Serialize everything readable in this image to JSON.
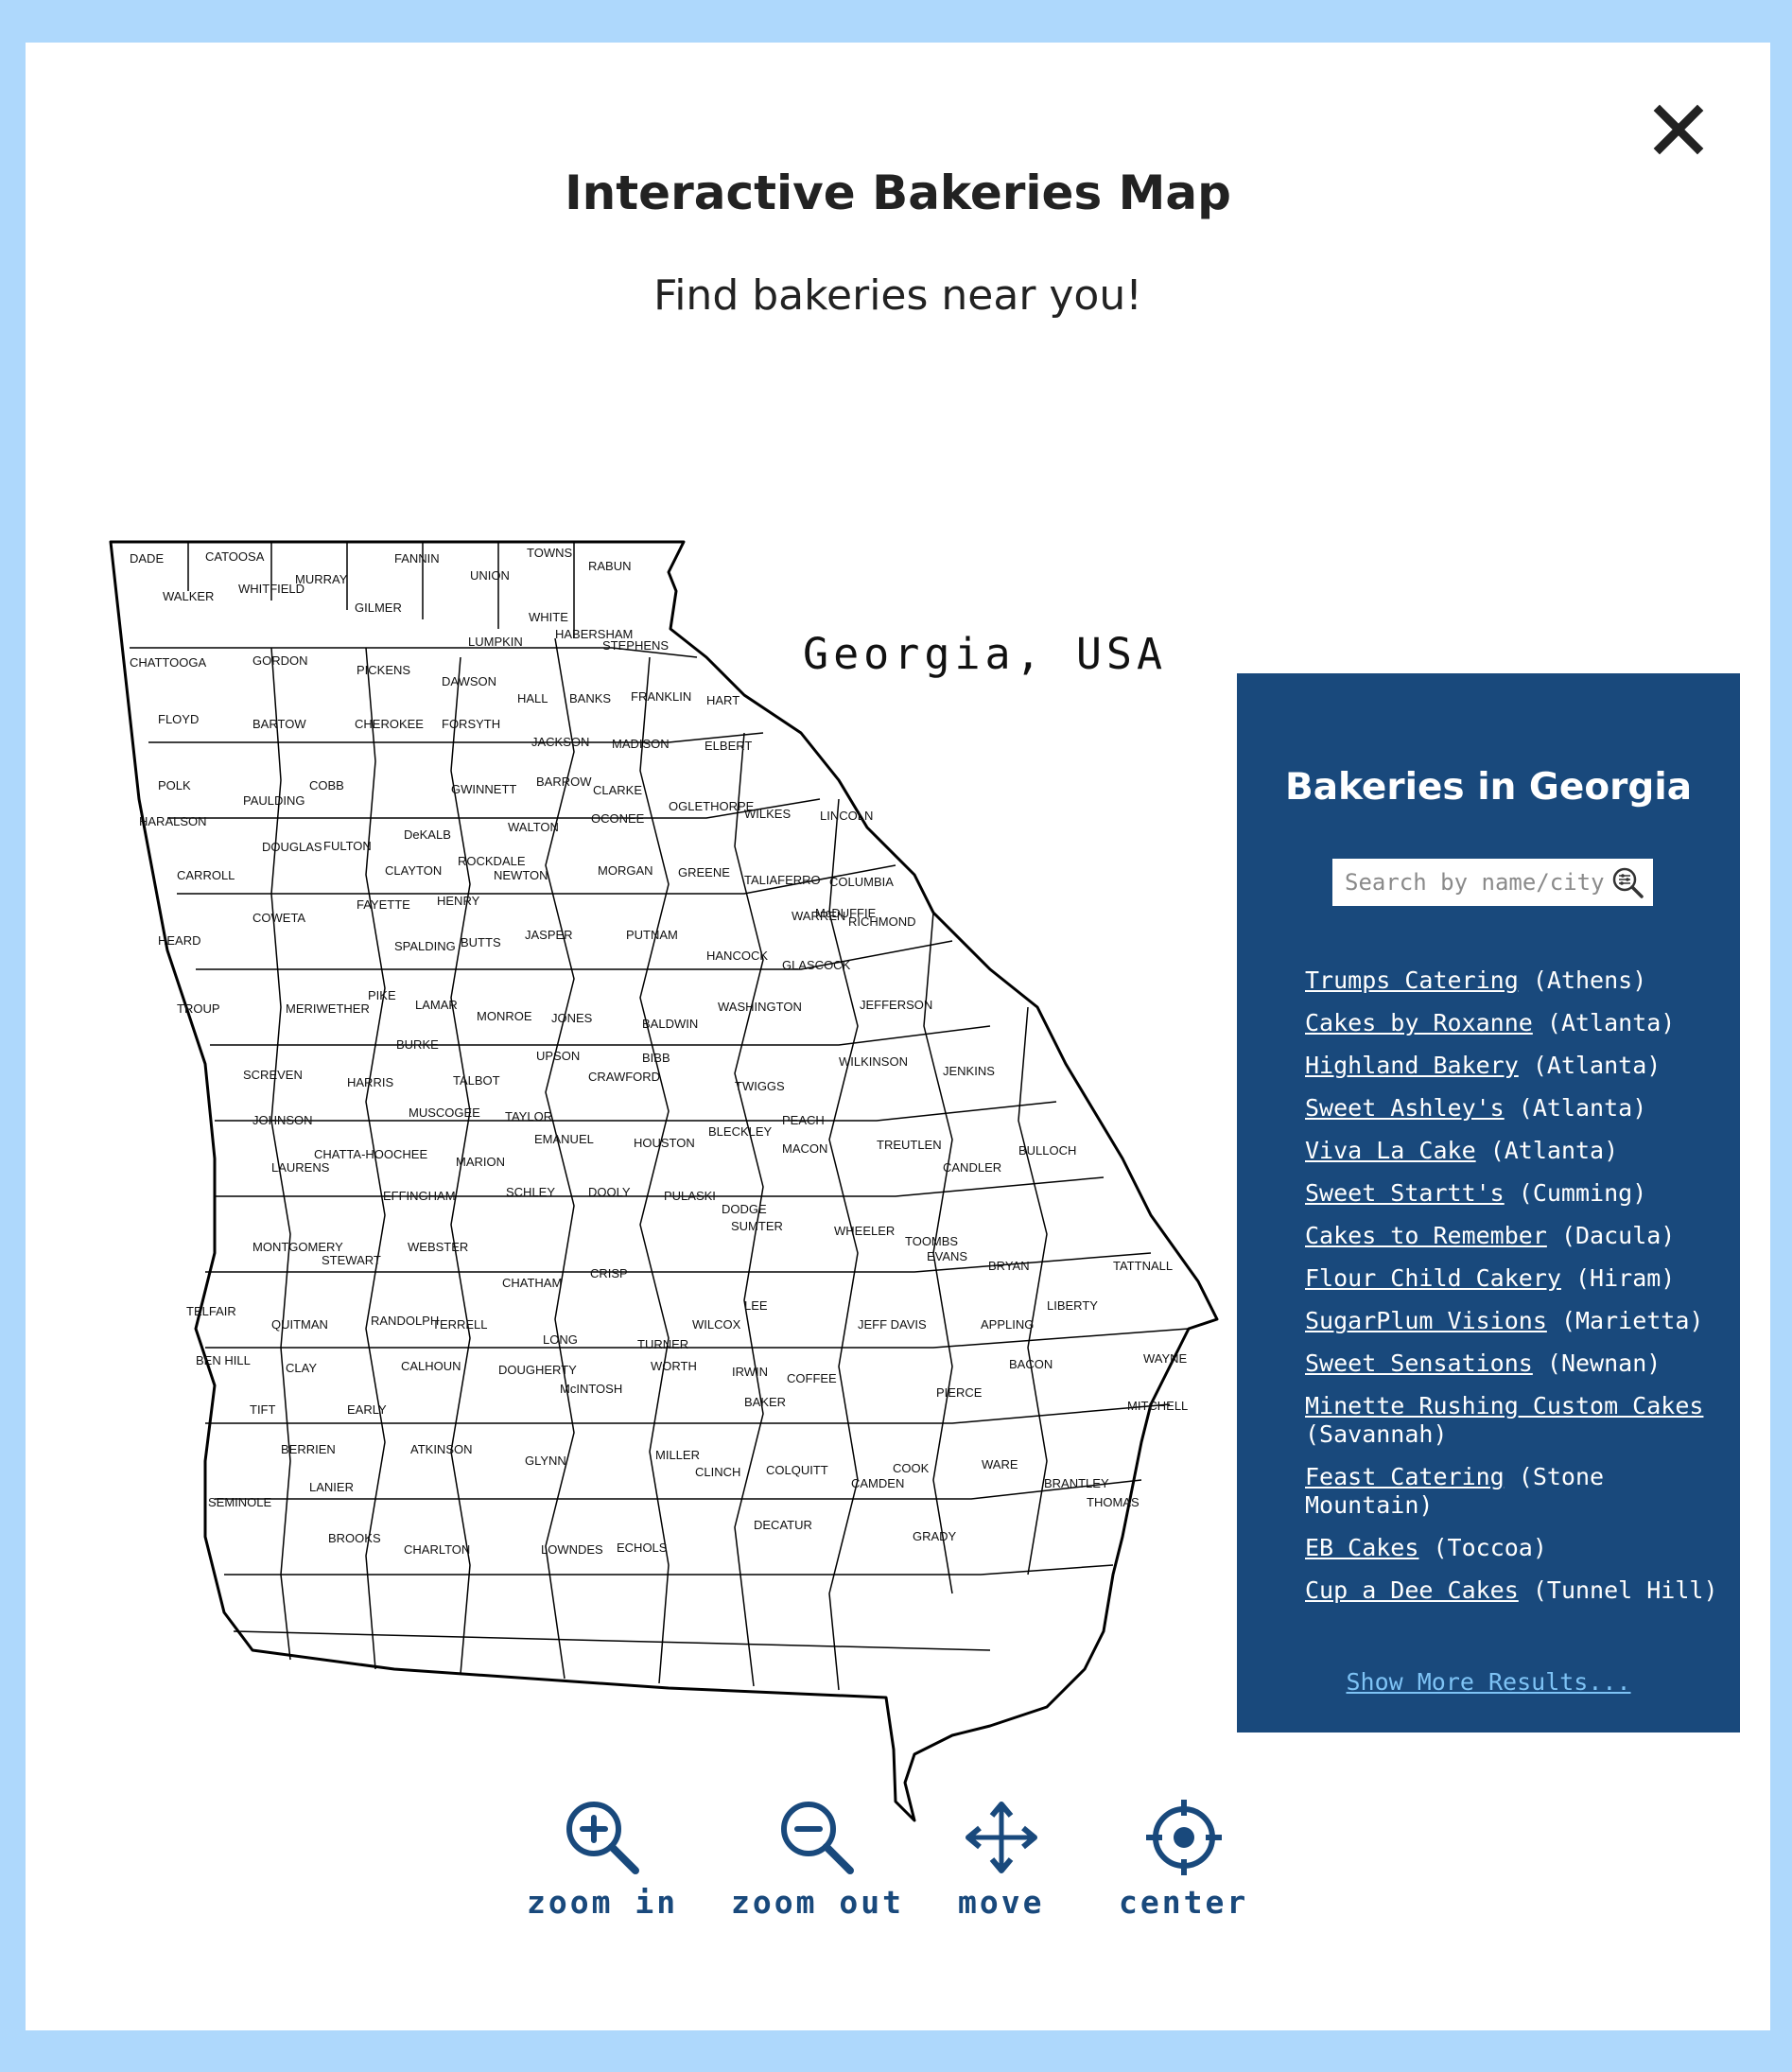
{
  "page": {
    "title": "Interactive Bakeries Map",
    "subtitle": "Find bakeries near you!",
    "close_icon": "close-icon"
  },
  "map": {
    "caption": "Georgia, USA",
    "counties": [
      "DADE",
      "CATOOSA",
      "FANNIN",
      "TOWNS",
      "UNION",
      "RABUN",
      "WALKER",
      "WHITFIELD",
      "MURRAY",
      "GILMER",
      "WHITE",
      "HABERSHAM",
      "STEPHENS",
      "LUMPKIN",
      "CHATTOOGA",
      "GORDON",
      "PICKENS",
      "DAWSON",
      "HALL",
      "BANKS",
      "FRANKLIN",
      "HART",
      "FLOYD",
      "BARTOW",
      "CHEROKEE",
      "FORSYTH",
      "JACKSON",
      "MADISON",
      "ELBERT",
      "POLK",
      "COBB",
      "GWINNETT",
      "BARROW",
      "CLARKE",
      "OGLETHORPE",
      "WILKES",
      "LINCOLN",
      "PAULDING",
      "HARALSON",
      "DOUGLAS",
      "FULTON",
      "DeKALB",
      "WALTON",
      "OCONEE",
      "ROCKDALE",
      "NEWTON",
      "MORGAN",
      "GREENE",
      "TALIAFERRO",
      "COLUMBIA",
      "CARROLL",
      "CLAYTON",
      "HENRY",
      "McDUFFIE",
      "FAYETTE",
      "COWETA",
      "WARREN",
      "RICHMOND",
      "HEARD",
      "SPALDING",
      "BUTTS",
      "JASPER",
      "PUTNAM",
      "HANCOCK",
      "GLASCOCK",
      "TROUP",
      "MERIWETHER",
      "PIKE",
      "LAMAR",
      "MONROE",
      "JONES",
      "BALDWIN",
      "WASHINGTON",
      "JEFFERSON",
      "BURKE",
      "UPSON",
      "BIBB",
      "WILKINSON",
      "JENKINS",
      "SCREVEN",
      "HARRIS",
      "TALBOT",
      "CRAWFORD",
      "TWIGGS",
      "JOHNSON",
      "MUSCOGEE",
      "TAYLOR",
      "PEACH",
      "EMANUEL",
      "HOUSTON",
      "BLECKLEY",
      "LAURENS",
      "CHATTA-HOOCHEE",
      "MARION",
      "MACON",
      "TREUTLEN",
      "CANDLER",
      "BULLOCH",
      "EFFINGHAM",
      "SCHLEY",
      "DOOLY",
      "PULASKI",
      "DODGE",
      "MONTGOMERY",
      "STEWART",
      "WEBSTER",
      "SUMTER",
      "WHEELER",
      "TOOMBS",
      "EVANS",
      "BRYAN",
      "TATTNALL",
      "CHATHAM",
      "CRISP",
      "WILCOX",
      "TELFAIR",
      "QUITMAN",
      "RANDOLPH",
      "TERRELL",
      "LEE",
      "JEFF DAVIS",
      "APPLING",
      "LIBERTY",
      "LONG",
      "TURNER",
      "BEN HILL",
      "CLAY",
      "CALHOUN",
      "DOUGHERTY",
      "WORTH",
      "IRWIN",
      "COFFEE",
      "BACON",
      "WAYNE",
      "McINTOSH",
      "TIFT",
      "EARLY",
      "BAKER",
      "PIERCE",
      "MITCHELL",
      "BERRIEN",
      "ATKINSON",
      "GLYNN",
      "MILLER",
      "COLQUITT",
      "COOK",
      "WARE",
      "BRANTLEY",
      "SEMINOLE",
      "LANIER",
      "CLINCH",
      "CAMDEN",
      "DECATUR",
      "GRADY",
      "THOMAS",
      "BROOKS",
      "CHARLTON",
      "LOWNDES",
      "ECHOLS"
    ]
  },
  "panel": {
    "title": "Bakeries in Georgia",
    "search_placeholder": "Search by name/city",
    "search_icon": "search-filter-icon",
    "show_more": "Show More Results...",
    "bakeries": [
      {
        "name": "Trumps Catering",
        "city": "(Athens)"
      },
      {
        "name": "Cakes by Roxanne",
        "city": "(Atlanta)"
      },
      {
        "name": "Highland Bakery",
        "city": "(Atlanta)"
      },
      {
        "name": "Sweet Ashley's",
        "city": "(Atlanta)"
      },
      {
        "name": "Viva La Cake",
        "city": "(Atlanta)"
      },
      {
        "name": "Sweet Startt's",
        "city": "(Cumming)"
      },
      {
        "name": "Cakes to Remember",
        "city": "(Dacula)"
      },
      {
        "name": "Flour Child Cakery",
        "city": "(Hiram)"
      },
      {
        "name": "SugarPlum Visions",
        "city": "(Marietta)"
      },
      {
        "name": "Sweet Sensations",
        "city": "(Newnan)"
      },
      {
        "name": "Minette Rushing Custom Cakes",
        "city": "(Savannah)"
      },
      {
        "name": "Feast Catering",
        "city": "(Stone Mountain)"
      },
      {
        "name": "EB Cakes",
        "city": "(Toccoa)"
      },
      {
        "name": "Cup a Dee Cakes",
        "city": "(Tunnel Hill)"
      }
    ]
  },
  "tools": [
    {
      "label": "zoom in",
      "icon": "zoom-in-icon"
    },
    {
      "label": "zoom out",
      "icon": "zoom-out-icon"
    },
    {
      "label": "move",
      "icon": "move-icon"
    },
    {
      "label": "center",
      "icon": "center-icon"
    }
  ],
  "colors": {
    "background": "#aed8fc",
    "panel": "#19497c",
    "tool_icons": "#19497c",
    "pointer_arrow": "#f07f19",
    "show_more_link": "#7ec3f5"
  }
}
